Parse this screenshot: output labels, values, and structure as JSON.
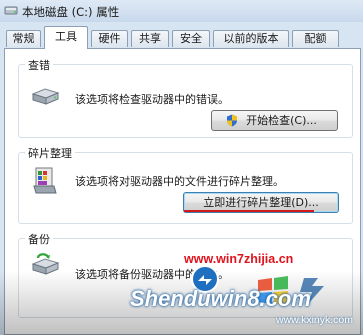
{
  "window": {
    "title": "本地磁盘 (C:) 属性"
  },
  "tabs": [
    {
      "label": "常规"
    },
    {
      "label": "工具"
    },
    {
      "label": "硬件"
    },
    {
      "label": "共享"
    },
    {
      "label": "安全"
    },
    {
      "label": "以前的版本"
    },
    {
      "label": "配额"
    }
  ],
  "active_tab": "工具",
  "error_check": {
    "title": "查错",
    "description": "该选项将检查驱动器中的错误。",
    "button_label": "开始检查(C)..."
  },
  "defrag": {
    "title": "碎片整理",
    "description": "该选项将对驱动器中的文件进行碎片整理。",
    "button_label": "立即进行碎片整理(D)..."
  },
  "backup": {
    "title": "备份",
    "description": "该选项将备份驱动器中的文件。"
  },
  "watermark": {
    "site_url": "www.win7zhijia.cn",
    "brand": "Shenduwin8.com",
    "small_url": "www.kxinyk.com"
  },
  "colors": {
    "accent_red": "#d21a1a",
    "tab_border": "#8e9fb3",
    "window_bg": "#d7e4f2"
  },
  "icons": {
    "title": "drive-icon",
    "error_check": "hard-drive-icon",
    "defrag": "defrag-icon",
    "backup": "backup-icon",
    "button_shield": "uac-shield-icon"
  }
}
